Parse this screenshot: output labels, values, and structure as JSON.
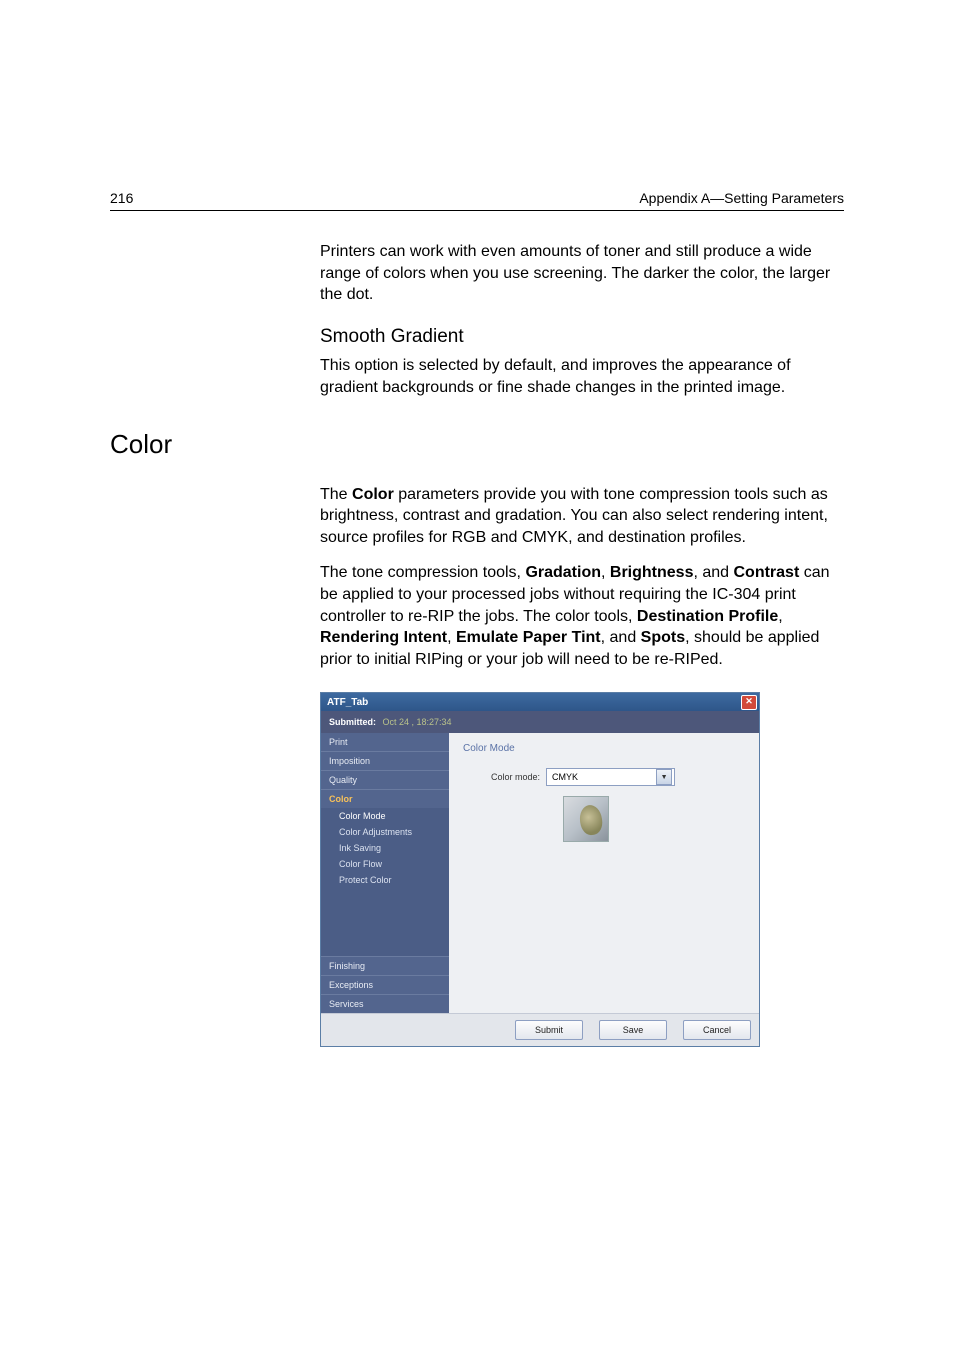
{
  "header": {
    "page_number": "216",
    "appendix": "Appendix A—Setting Parameters"
  },
  "intro_para": "Printers can work with even amounts of toner and still produce a wide range of colors when you use screening. The darker the color, the larger the dot.",
  "smooth": {
    "heading": "Smooth Gradient",
    "para": "This option is selected by default, and improves the appearance of gradient backgrounds or fine shade changes in the printed image."
  },
  "section_heading": "Color",
  "color_para1": {
    "pre": "The ",
    "b1": "Color",
    "post": " parameters provide you with tone compression tools such as brightness, contrast and gradation. You can also select rendering intent, source profiles for RGB and CMYK, and destination profiles."
  },
  "color_para2": {
    "s1": "The tone compression tools, ",
    "b1": "Gradation",
    "s2": ", ",
    "b2": "Brightness",
    "s3": ", and ",
    "b3": "Contrast",
    "s4": " can be applied to your processed jobs without requiring the IC-304 print controller to re-RIP the jobs. The color tools, ",
    "b4": "Destination Profile",
    "s5": ", ",
    "b5": "Rendering Intent",
    "s6": ", ",
    "b6": "Emulate Paper Tint",
    "s7": ", and ",
    "b7": "Spots",
    "s8": ", should be applied prior to initial RIPing or your job will need to be re-RIPed."
  },
  "dialog": {
    "title": "ATF_Tab",
    "submitted_label": "Submitted:",
    "submitted_value": "Oct 24 , 18:27:34",
    "sidebar": {
      "items": [
        "Print",
        "Imposition",
        "Quality",
        "Color",
        "Finishing",
        "Exceptions",
        "Services"
      ],
      "sub_items": [
        "Color Mode",
        "Color Adjustments",
        "Ink Saving",
        "Color Flow",
        "Protect Color"
      ]
    },
    "panel": {
      "title": "Color Mode",
      "field_label": "Color mode:",
      "field_value": "CMYK"
    },
    "buttons": {
      "submit": "Submit",
      "save": "Save",
      "cancel": "Cancel"
    }
  }
}
